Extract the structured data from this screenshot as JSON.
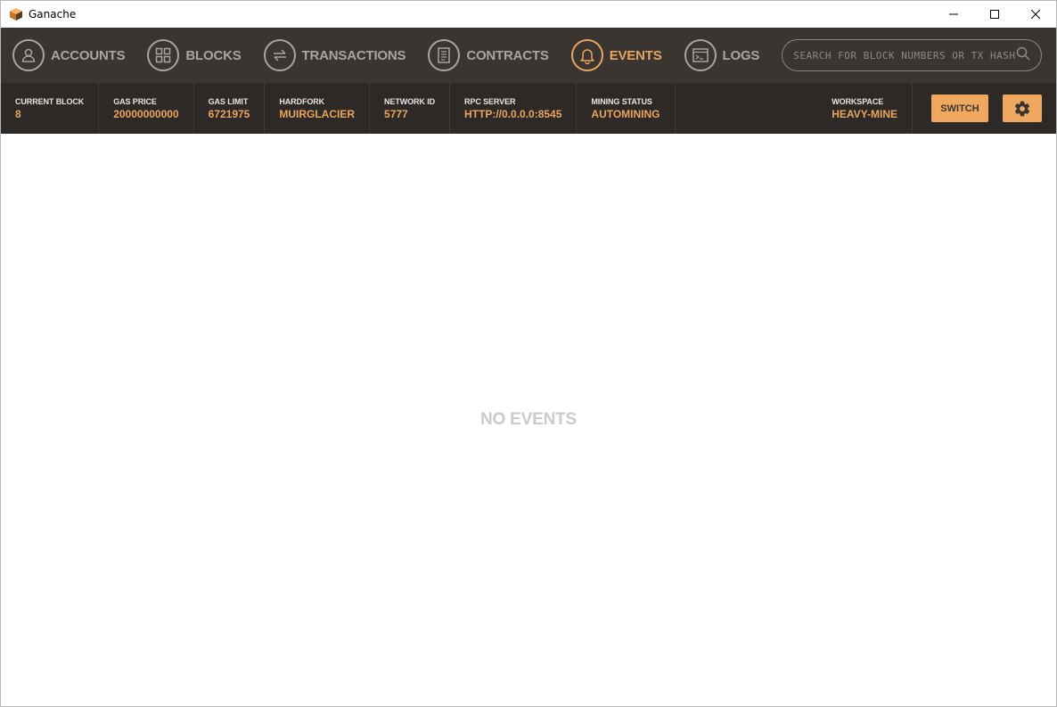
{
  "window": {
    "title": "Ganache",
    "controls": [
      "minimize",
      "maximize",
      "close"
    ]
  },
  "nav": {
    "items": [
      {
        "label": "ACCOUNTS",
        "icon": "person-icon",
        "active": false
      },
      {
        "label": "BLOCKS",
        "icon": "blocks-grid-icon",
        "active": false
      },
      {
        "label": "TRANSACTIONS",
        "icon": "transfer-arrows-icon",
        "active": false
      },
      {
        "label": "CONTRACTS",
        "icon": "document-icon",
        "active": false
      },
      {
        "label": "EVENTS",
        "icon": "bell-icon",
        "active": true
      },
      {
        "label": "LOGS",
        "icon": "terminal-icon",
        "active": false
      }
    ],
    "search": {
      "placeholder": "SEARCH FOR BLOCK NUMBERS OR TX HASHES",
      "value": ""
    }
  },
  "status": {
    "current_block": {
      "label": "CURRENT BLOCK",
      "value": "8"
    },
    "gas_price": {
      "label": "GAS PRICE",
      "value": "20000000000"
    },
    "gas_limit": {
      "label": "GAS LIMIT",
      "value": "6721975"
    },
    "hardfork": {
      "label": "HARDFORK",
      "value": "MUIRGLACIER"
    },
    "network_id": {
      "label": "NETWORK ID",
      "value": "5777"
    },
    "rpc_server": {
      "label": "RPC SERVER",
      "value": "HTTP://0.0.0.0:8545"
    },
    "mining_status": {
      "label": "MINING STATUS",
      "value": "AUTOMINING"
    },
    "workspace": {
      "label": "WORKSPACE",
      "value": "HEAVY-MINE"
    },
    "switch_label": "SWITCH"
  },
  "main": {
    "empty_message": "NO EVENTS"
  },
  "colors": {
    "accent": "#e9a55e",
    "nav_bg": "#3b3532",
    "status_bg": "#2d2927",
    "muted": "#a7a4a2"
  }
}
